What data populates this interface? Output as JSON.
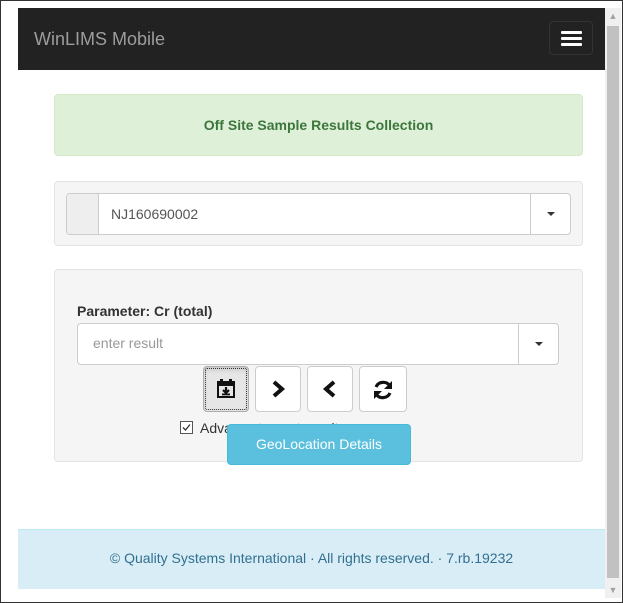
{
  "navbar": {
    "brand": "WinLIMS Mobile",
    "menu_icon": "hamburger-menu-icon"
  },
  "alert": {
    "text": "Off Site Sample Results Collection"
  },
  "sample_select": {
    "value": "NJ160690002",
    "dropdown_icon": "caret-down-icon"
  },
  "parameter": {
    "label": "Parameter: Cr (total)",
    "input_value": "",
    "input_placeholder": "enter result",
    "dropdown_icon": "caret-down-icon"
  },
  "actions": [
    {
      "name": "save",
      "icon": "save-icon"
    },
    {
      "name": "next",
      "icon": "chevron-right-icon"
    },
    {
      "name": "previous",
      "icon": "chevron-left-icon"
    },
    {
      "name": "refresh",
      "icon": "refresh-icon"
    }
  ],
  "advance_option": {
    "checked": true,
    "label": "Advance to next result upon save."
  },
  "geo_button": {
    "label": "GeoLocation Details"
  },
  "footer": {
    "copyright": "©",
    "company_link": "Quality Systems International",
    "rights": "· All rights reserved. · 7.rb.19232"
  },
  "colors": {
    "navbar_bg": "#222222",
    "alert_bg": "#dff0d8",
    "alert_text": "#3c763d",
    "info_button": "#5bc0de",
    "footer_bg": "#d9edf7",
    "footer_text": "#31708f"
  }
}
